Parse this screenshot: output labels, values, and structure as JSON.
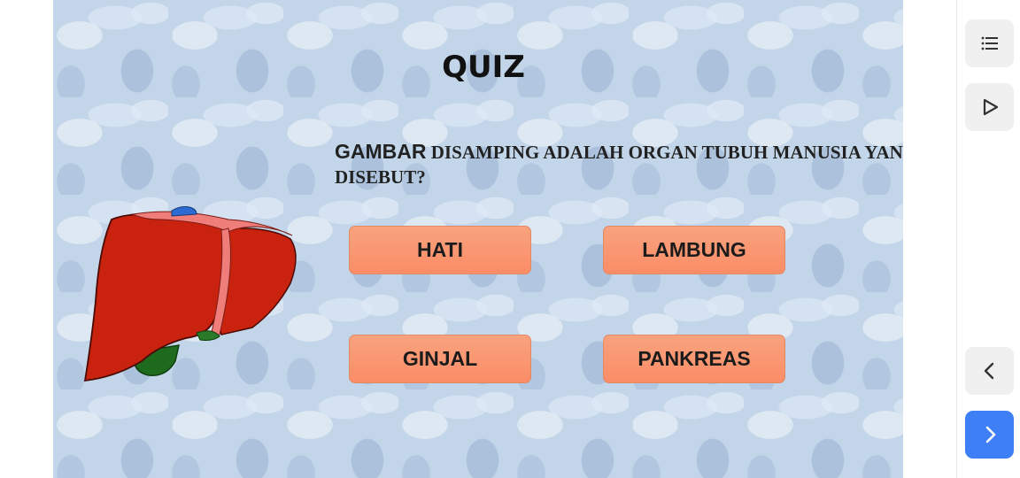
{
  "quiz": {
    "title": "QUIZ",
    "question_lead": "GAMBAR",
    "question_rest": " disamping adalah organ tubuh manusia yang",
    "question_line2": "DISEBUT?",
    "answers": [
      "HATI",
      "LAMBUNG",
      "GINJAL",
      "PANKREAS"
    ]
  },
  "sidebar": {
    "icons": [
      "list-icon",
      "play-icon",
      "chevron-left-icon",
      "chevron-right-icon"
    ]
  },
  "colors": {
    "answer_button": "#fb956f",
    "slide_background": "#c3d6e9",
    "next_button": "#3e7ff5",
    "liver_red": "#c92310",
    "liver_pink": "#ef7d7a",
    "gallbladder_green": "#1e6b1e"
  }
}
